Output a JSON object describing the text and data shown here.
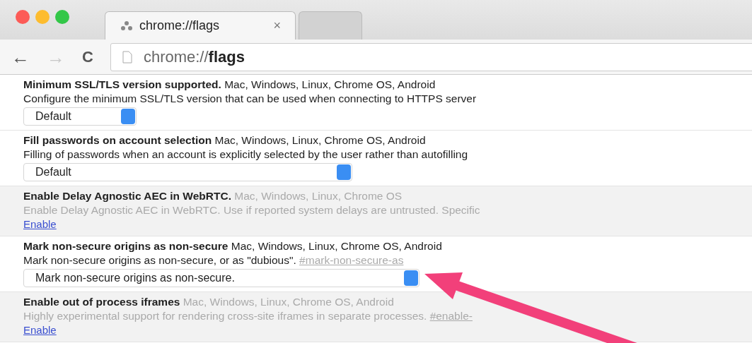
{
  "tabs": [
    {
      "label": "chrome://flags",
      "selected": true,
      "close": "×"
    },
    {
      "selected": false
    }
  ],
  "toolbar": {
    "back": "←",
    "forward": "→",
    "reload": "C",
    "address": "chrome://",
    "address_bold": "flags"
  },
  "experiments": [
    {
      "title": "Minimum SSL/TLS version supported.",
      "platforms": "Mac, Windows, Linux, Chrome OS, Android",
      "description": "Configure the minimum SSL/TLS version that can be used when connecting to HTTPS server",
      "disabled": false,
      "control": {
        "kind": "select",
        "value": "Default"
      }
    },
    {
      "title": "Fill passwords on account selection",
      "platforms": "Mac, Windows, Linux, Chrome OS, Android",
      "description": "Filling of passwords when an account is explicitly selected by the user rather than autofilling",
      "disabled": false,
      "control": {
        "kind": "select",
        "value": "Default"
      }
    },
    {
      "title": "Enable Delay Agnostic AEC in WebRTC.",
      "platforms": "Mac, Windows, Linux, Chrome OS",
      "description": "Enable Delay Agnostic AEC in WebRTC. Use if reported system delays are untrusted. Specific",
      "disabled": true,
      "control": {
        "kind": "link",
        "value": "Enable"
      }
    },
    {
      "title": "Mark non-secure origins as non-secure",
      "platforms": "Mac, Windows, Linux, Chrome OS, Android",
      "description": "Mark non-secure origins as non-secure, or as \"dubious\".",
      "hash": "#mark-non-secure-as",
      "disabled": false,
      "control": {
        "kind": "select",
        "value": "Mark non-secure origins as non-secure."
      }
    },
    {
      "title": "Enable out of process iframes",
      "platforms": "Mac, Windows, Linux, Chrome OS, Android",
      "description": "Highly experimental support for rendering cross-site iframes in separate processes.",
      "hash": "#enable-",
      "disabled": true,
      "control": {
        "kind": "link",
        "value": "Enable"
      }
    }
  ],
  "annotation": {
    "kind": "arrow",
    "color": "#f2407a"
  }
}
